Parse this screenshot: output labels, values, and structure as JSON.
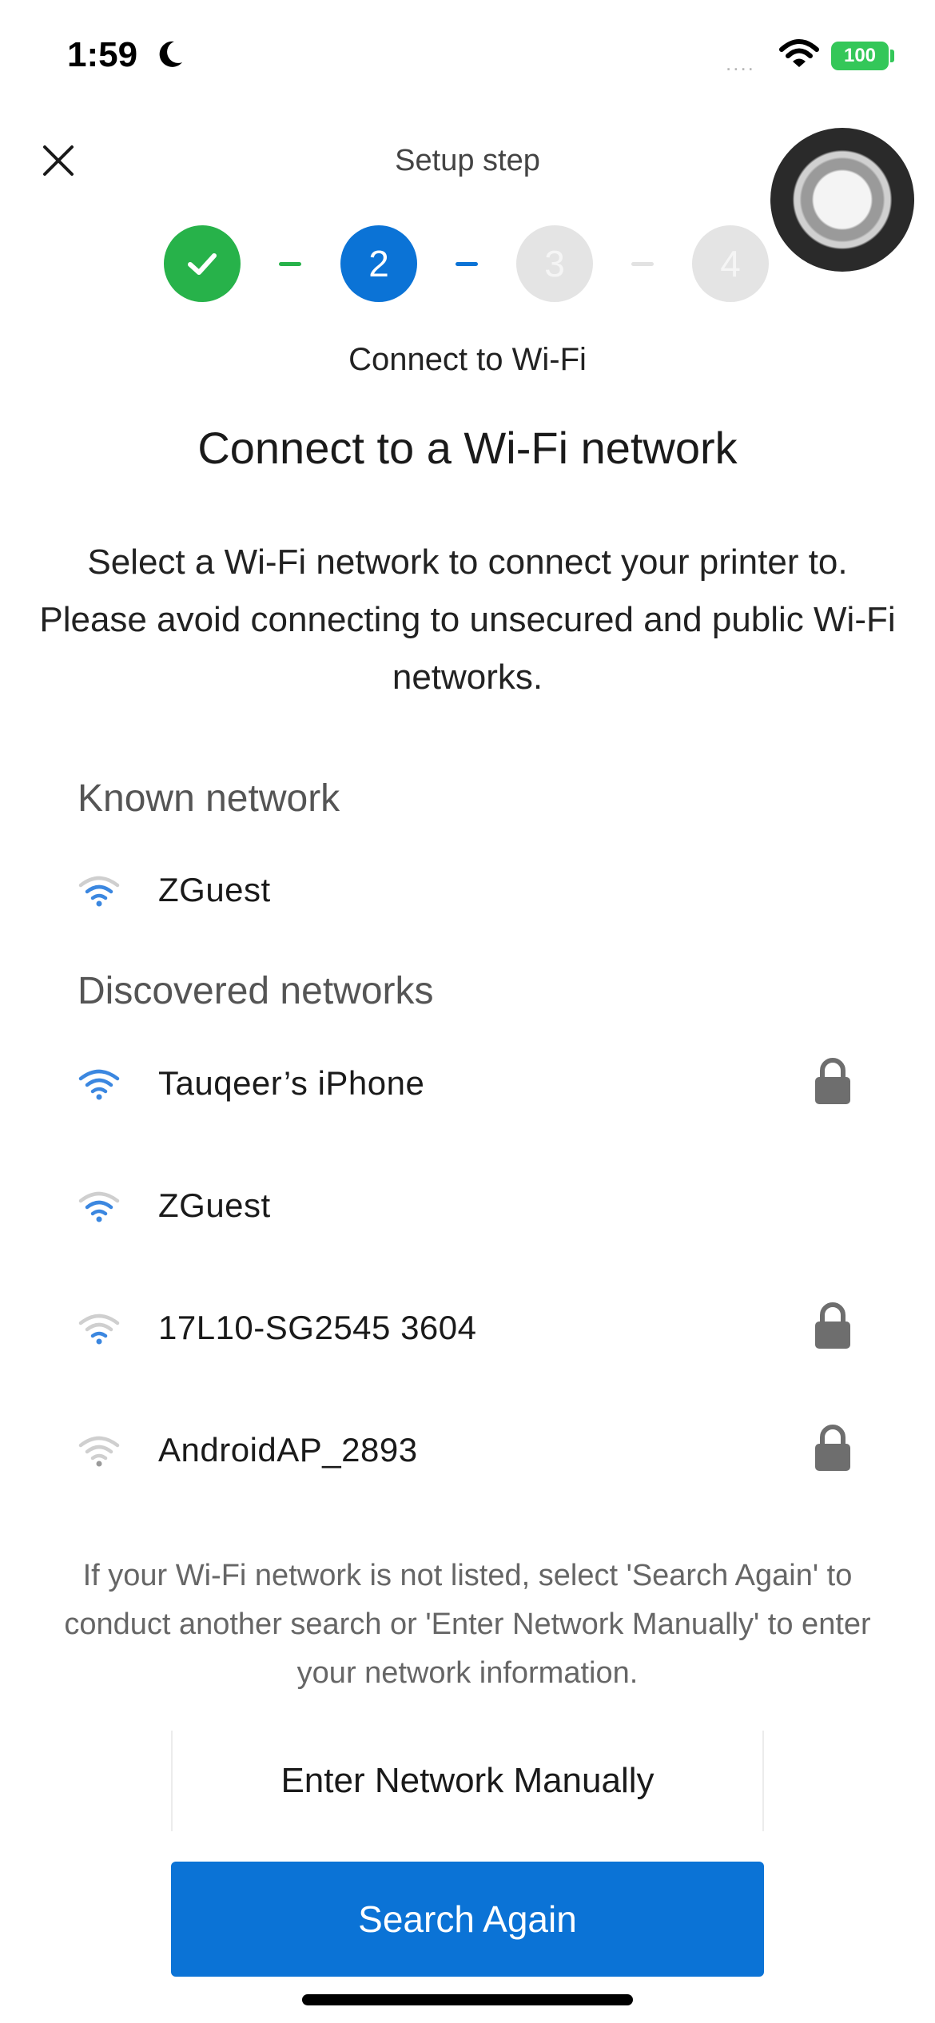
{
  "status_bar": {
    "time": "1:59",
    "signal": "....",
    "battery": "100",
    "icons": [
      "moon-icon",
      "wifi-icon",
      "battery-icon"
    ]
  },
  "header": {
    "title": "Setup step",
    "close_icon": "close-icon"
  },
  "stepper": {
    "steps": [
      {
        "label": "",
        "state": "done",
        "icon": "check-icon"
      },
      {
        "label": "2",
        "state": "current"
      },
      {
        "label": "3",
        "state": "upcoming"
      },
      {
        "label": "4",
        "state": "upcoming"
      }
    ],
    "current_label": "Connect to Wi-Fi"
  },
  "main": {
    "title": "Connect to a Wi-Fi network",
    "description": "Select a Wi-Fi network to connect your printer to. Please avoid connecting to unsecured and public Wi-Fi networks."
  },
  "known": {
    "heading": "Known network",
    "networks": [
      {
        "name": "ZGuest",
        "strength": 3,
        "secured": false
      }
    ]
  },
  "discovered": {
    "heading": "Discovered networks",
    "networks": [
      {
        "name": "Tauqeer’s iPhone",
        "strength": 4,
        "secured": true
      },
      {
        "name": "ZGuest",
        "strength": 3,
        "secured": false
      },
      {
        "name": "17L10-SG2545 3604",
        "strength": 2,
        "secured": true
      },
      {
        "name": "AndroidAP_2893",
        "strength": 1,
        "secured": true
      }
    ]
  },
  "footer": {
    "note": "If your Wi-Fi network is not listed, select 'Search Again' to conduct another search or 'Enter Network Manually' to enter your network information.",
    "manual_button": "Enter Network Manually",
    "search_button": "Search Again"
  },
  "colors": {
    "primary": "#0b73d6",
    "success": "#27b24a",
    "wifi_active": "#3b87e0",
    "wifi_inactive": "#cfcfcf",
    "lock": "#6e6e6e"
  }
}
